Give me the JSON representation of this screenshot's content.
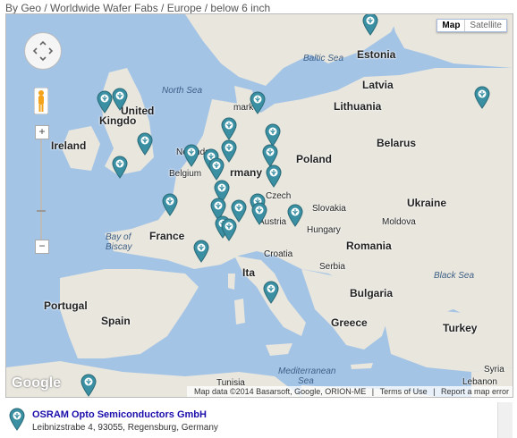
{
  "breadcrumb": "By Geo / Worldwide Wafer Fabs / Europe / below 6 inch",
  "map_type": {
    "map": "Map",
    "satellite": "Satellite"
  },
  "zoom": {
    "plus": "+",
    "minus": "−"
  },
  "google_logo": "Google",
  "attribution": {
    "data": "Map data ©2014 Basarsoft, Google, ORION-ME",
    "terms": "Terms of Use",
    "report": "Report a map error"
  },
  "colors": {
    "water": "#a4c4e6",
    "land": "#e8e6dd",
    "marker": "#3a8fa3",
    "link": "#1a0dab"
  },
  "places": {
    "estonia": "Estonia",
    "latvia": "Latvia",
    "lithuania": "Lithuania",
    "united_kingdom_1": "United",
    "united_kingdom_2": "Kingdo",
    "ireland": "Ireland",
    "belarus": "Belarus",
    "poland": "Poland",
    "netherlands": "Ne    ands",
    "belgium": "Belgium",
    "germany": "rmany",
    "czech": "Czech",
    "ukraine": "Ukraine",
    "slovakia": "Slovakia",
    "moldova": "Moldova",
    "france": "France",
    "austria": "Austria",
    "hungary": "Hungary",
    "romania": "Romania",
    "croatia": "Croatia",
    "serbia": "Serbia",
    "italy": "Ita",
    "bulgaria": "Bulgaria",
    "portugal": "Portugal",
    "spain": "Spain",
    "greece": "Greece",
    "turkey": "Turkey",
    "tunisia": "Tunisia",
    "syria": "Syria",
    "lebanon": "Lebanon",
    "denmark": "mark"
  },
  "seas": {
    "baltic": "Baltic Sea",
    "north": "North Sea",
    "bay_1": "Bay of",
    "bay_2": "Biscay",
    "black": "Black Sea",
    "med_1": "Mediterranean",
    "med_2": "Sea"
  },
  "result": {
    "name": "OSRAM Opto Semiconductors GmbH",
    "address": "Leibnizstrabe 4, 93055, Regensburg, Germany"
  }
}
